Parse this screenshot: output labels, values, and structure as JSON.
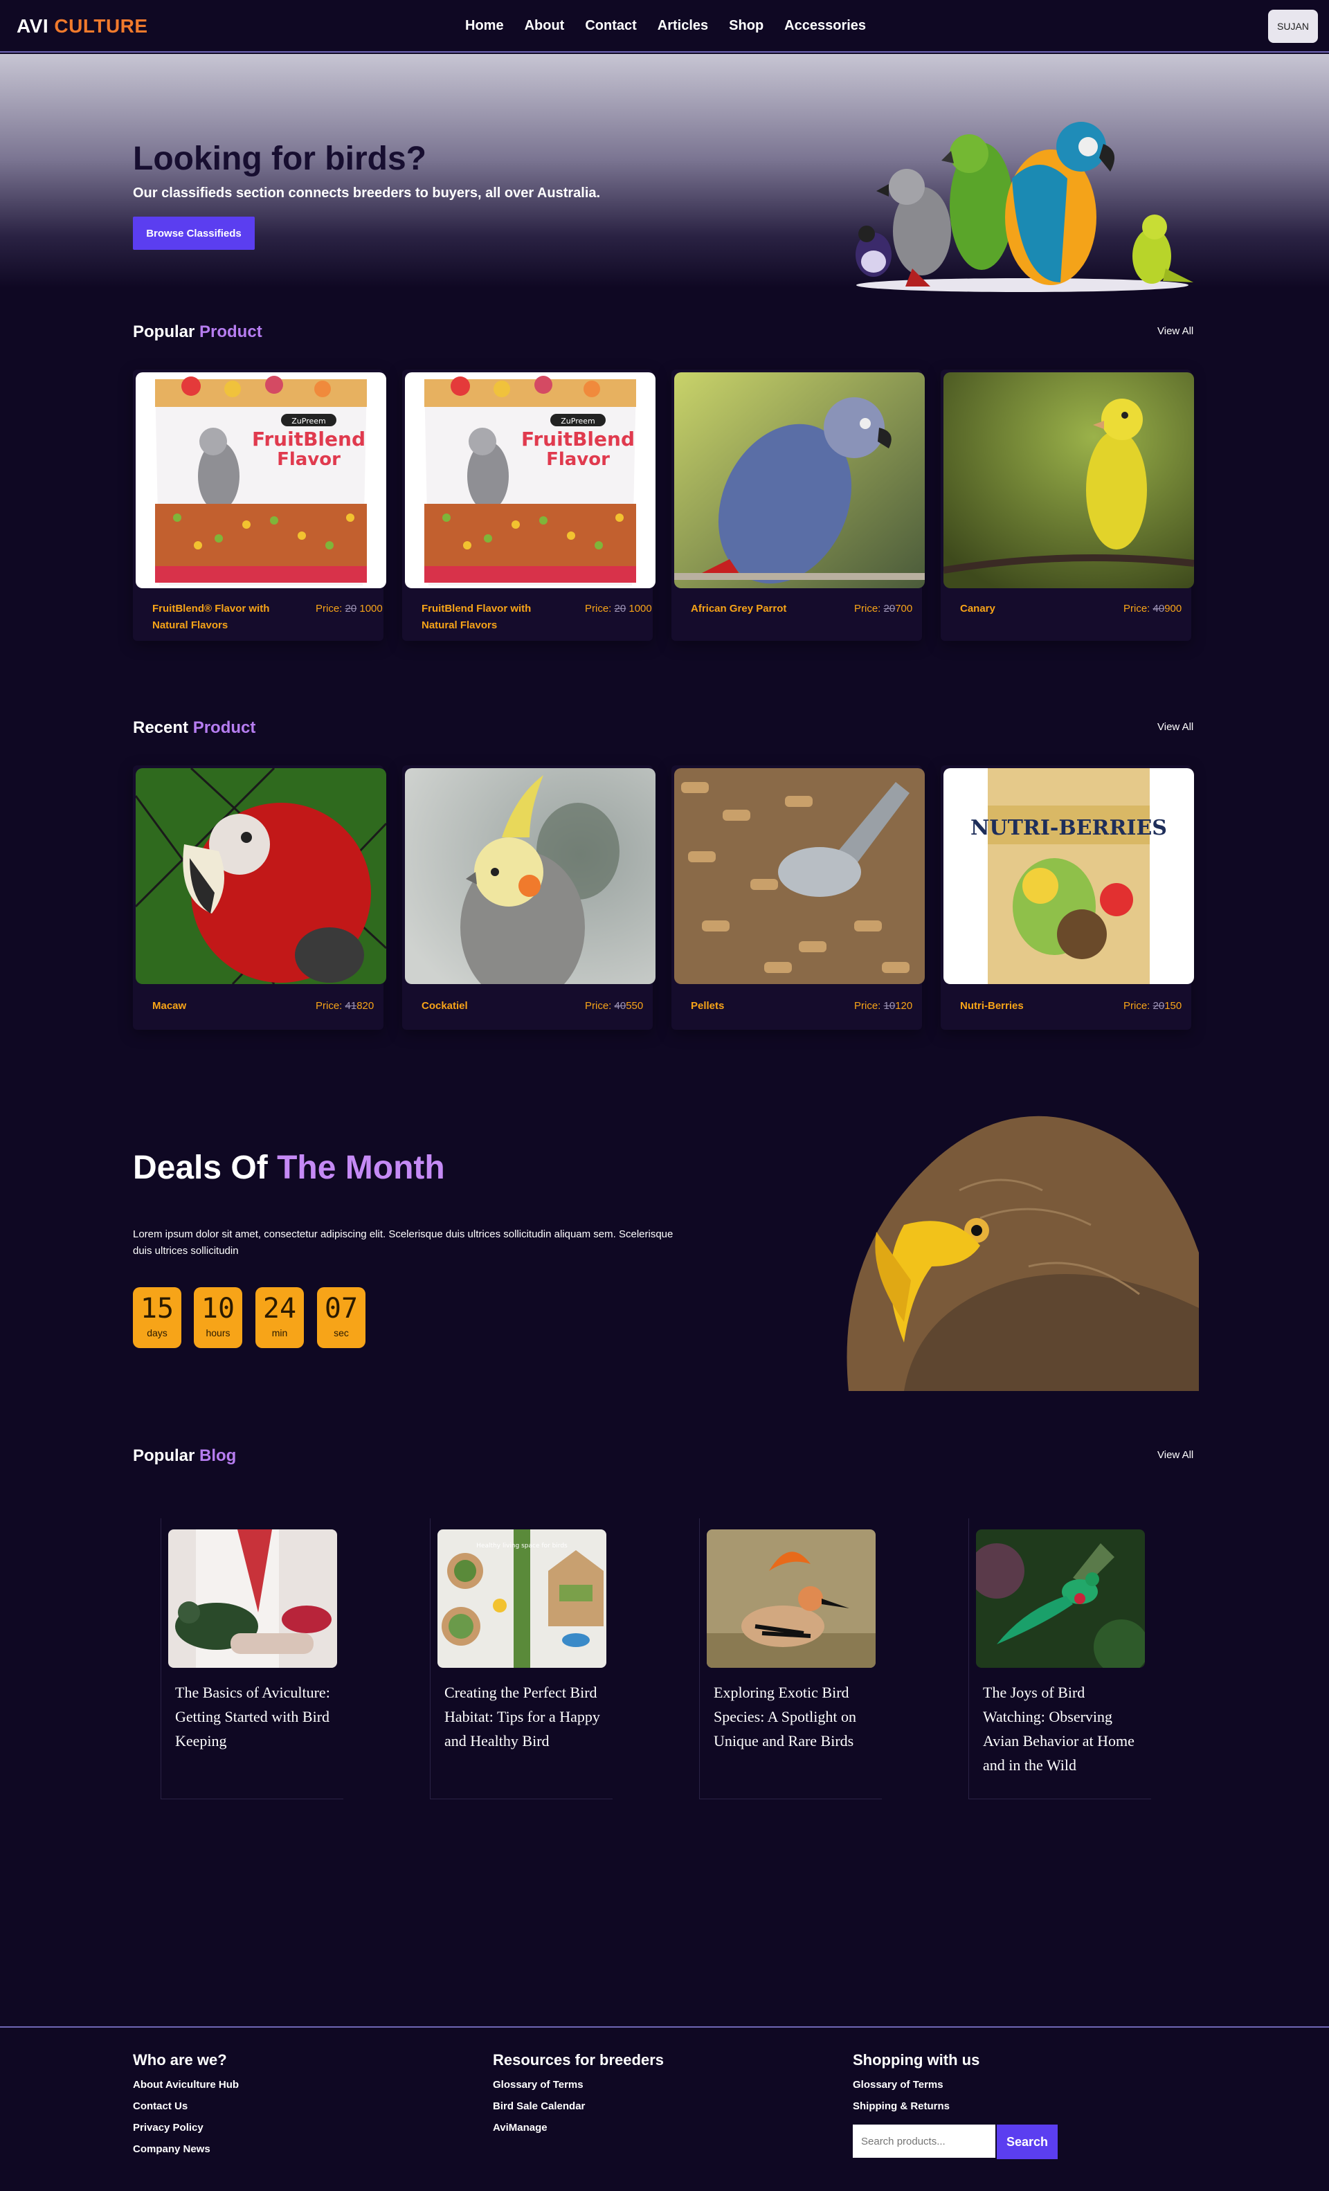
{
  "nav": {
    "logo_a": "AVI",
    "logo_b": "CULTURE",
    "links": [
      "Home",
      "About",
      "Contact",
      "Articles",
      "Shop",
      "Accessories"
    ],
    "user": "SUJAN"
  },
  "hero": {
    "title": "Looking for birds?",
    "subtitle": "Our classifieds section connects breeders to buyers, all over Australia.",
    "button": "Browse Classifieds"
  },
  "popular": {
    "title_a": "Popular",
    "title_b": "Product",
    "view_all": "View All",
    "items": [
      {
        "name": "FruitBlend® Flavor with Natural Flavors",
        "price_label": "Price:",
        "old": "20",
        "new": "1000"
      },
      {
        "name": "FruitBlend Flavor with Natural Flavors",
        "price_label": "Price:",
        "old": "20",
        "new": "1000"
      },
      {
        "name": "African Grey Parrot",
        "price_label": "Price:",
        "old": "20",
        "new": "700"
      },
      {
        "name": "Canary",
        "price_label": "Price:",
        "old": "40",
        "new": "900"
      }
    ]
  },
  "recent": {
    "title_a": "Recent",
    "title_b": "Product",
    "view_all": "View All",
    "items": [
      {
        "name": "Macaw",
        "price_label": "Price:",
        "old": "41",
        "new": "820"
      },
      {
        "name": "Cockatiel",
        "price_label": "Price:",
        "old": "40",
        "new": "550"
      },
      {
        "name": "Pellets",
        "price_label": "Price:",
        "old": "10",
        "new": "120"
      },
      {
        "name": "Nutri-Berries",
        "price_label": "Price:",
        "old": "20",
        "new": "150"
      }
    ]
  },
  "deals": {
    "title_a": "Deals Of",
    "title_b": "The Month",
    "text": "Lorem ipsum dolor sit amet, consectetur adipiscing elit. Scelerisque duis ultrices sollicitudin aliquam sem. Scelerisque duis ultrices sollicitudin",
    "countdown": [
      {
        "n": "15",
        "l": "days"
      },
      {
        "n": "10",
        "l": "hours"
      },
      {
        "n": "24",
        "l": "min"
      },
      {
        "n": "07",
        "l": "sec"
      }
    ]
  },
  "blog": {
    "title_a": "Popular",
    "title_b": "Blog",
    "view_all": "View All",
    "posts": [
      "The Basics of Aviculture: Getting Started with Bird Keeping",
      "Creating the Perfect Bird Habitat: Tips for a Happy and Healthy Bird",
      "Exploring Exotic Bird Species: A Spotlight on Unique and Rare Birds",
      "The Joys of Bird Watching: Observing Avian Behavior at Home and in the Wild"
    ],
    "img_caption": "Healthy living space for birds"
  },
  "footer": {
    "col1": {
      "title": "Who are we?",
      "links": [
        "About Aviculture Hub",
        "Contact Us",
        "Privacy Policy",
        "Company News"
      ]
    },
    "col2": {
      "title": "Resources for breeders",
      "links": [
        "Glossary of Terms",
        "Bird Sale Calendar",
        "AviManage"
      ]
    },
    "col3": {
      "title": "Shopping with us",
      "links": [
        "Glossary of Terms",
        "Shipping & Returns"
      ]
    },
    "search_placeholder": "Search products...",
    "search_button": "Search"
  },
  "colors": {
    "bg": "#0f0823",
    "accent": "#5b3ef0",
    "orange": "#f7a418",
    "purple": "#b67df0",
    "logo_orange": "#f07a2c"
  }
}
